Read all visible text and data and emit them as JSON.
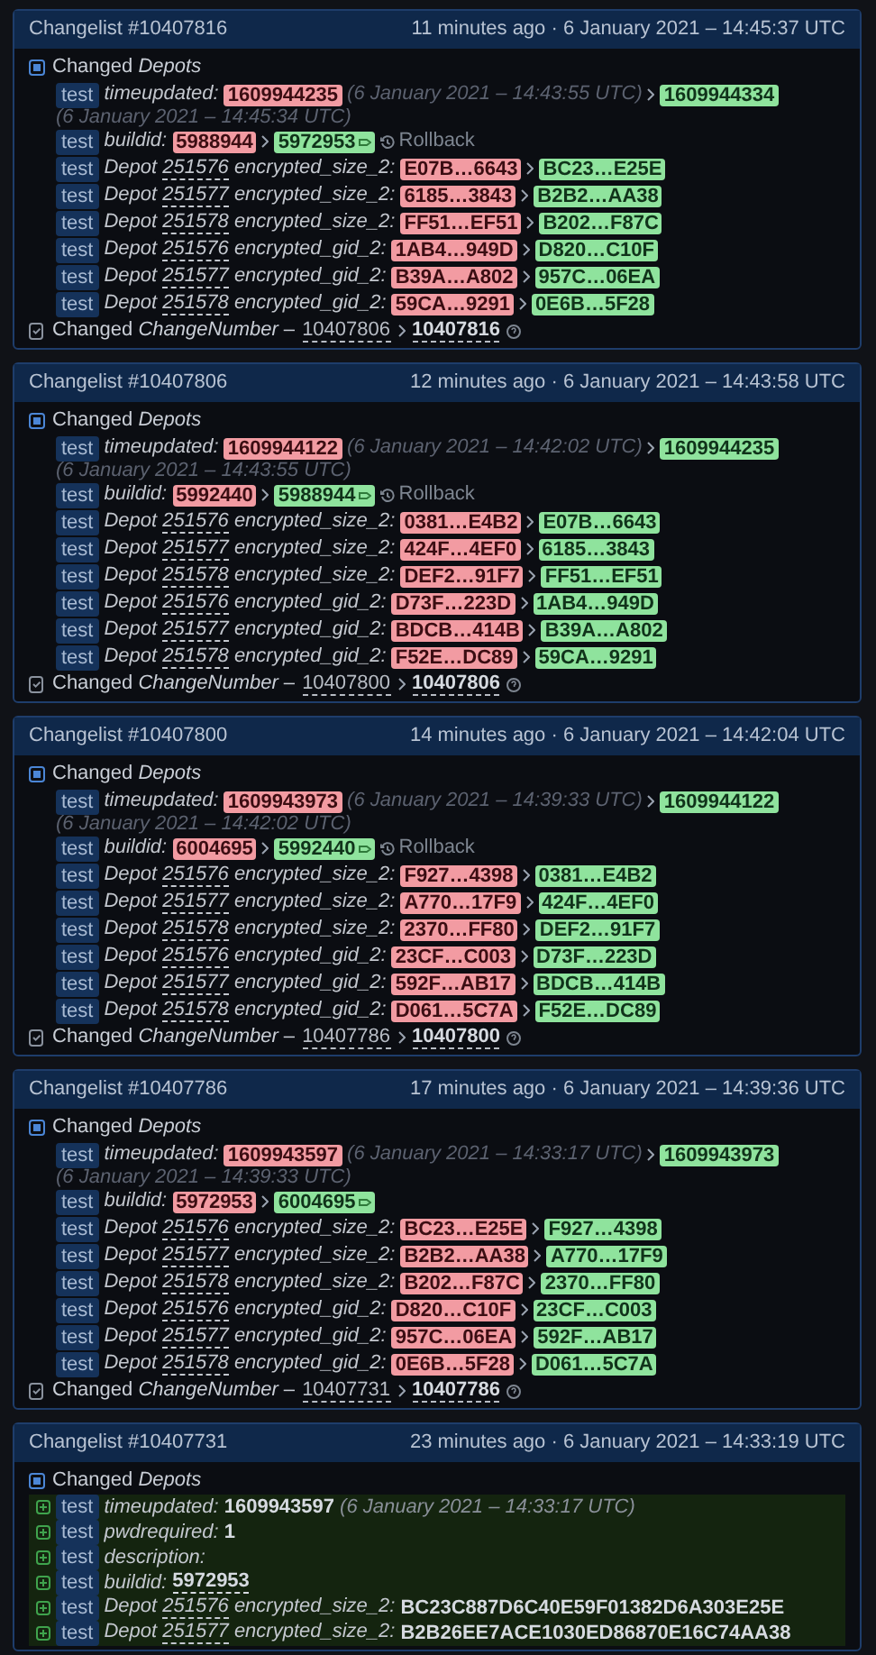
{
  "changelists": [
    {
      "title": "Changelist #10407816",
      "time": "11 minutes ago · 6 January 2021 – 14:45:37 UTC",
      "section": "Changed *Depots*",
      "rows": [
        {
          "kind": "time",
          "branch": "test",
          "key": "timeupdated:",
          "old": "1609944235",
          "old_note": "(6 January 2021 – 14:43:55 UTC)",
          "new": "1609944334",
          "new_note": "(6 January 2021 – 14:45:34 UTC)"
        },
        {
          "kind": "build",
          "branch": "test",
          "key": "buildid:",
          "old": "5988944",
          "new": "5972953",
          "rollback": "Rollback"
        },
        {
          "kind": "depot",
          "branch": "test",
          "prefix": "Depot",
          "depot": "251576",
          "key": "encrypted_size_2:",
          "old": "E07B…6643",
          "new": "BC23…E25E"
        },
        {
          "kind": "depot",
          "branch": "test",
          "prefix": "Depot",
          "depot": "251577",
          "key": "encrypted_size_2:",
          "old": "6185…3843",
          "new": "B2B2…AA38"
        },
        {
          "kind": "depot",
          "branch": "test",
          "prefix": "Depot",
          "depot": "251578",
          "key": "encrypted_size_2:",
          "old": "FF51…EF51",
          "new": "B202…F87C"
        },
        {
          "kind": "depot",
          "branch": "test",
          "prefix": "Depot",
          "depot": "251576",
          "key": "encrypted_gid_2:",
          "old": "1AB4…949D",
          "new": "D820…C10F"
        },
        {
          "kind": "depot",
          "branch": "test",
          "prefix": "Depot",
          "depot": "251577",
          "key": "encrypted_gid_2:",
          "old": "B39A…A802",
          "new": "957C…06EA"
        },
        {
          "kind": "depot",
          "branch": "test",
          "prefix": "Depot",
          "depot": "251578",
          "key": "encrypted_gid_2:",
          "old": "59CA…9291",
          "new": "0E6B…5F28"
        }
      ],
      "change_number": {
        "label": "Changed *ChangeNumber* –",
        "old": "10407806",
        "new": "10407816"
      }
    },
    {
      "title": "Changelist #10407806",
      "time": "12 minutes ago · 6 January 2021 – 14:43:58 UTC",
      "section": "Changed *Depots*",
      "rows": [
        {
          "kind": "time",
          "branch": "test",
          "key": "timeupdated:",
          "old": "1609944122",
          "old_note": "(6 January 2021 – 14:42:02 UTC)",
          "new": "1609944235",
          "new_note": "(6 January 2021 – 14:43:55 UTC)"
        },
        {
          "kind": "build",
          "branch": "test",
          "key": "buildid:",
          "old": "5992440",
          "new": "5988944",
          "rollback": "Rollback"
        },
        {
          "kind": "depot",
          "branch": "test",
          "prefix": "Depot",
          "depot": "251576",
          "key": "encrypted_size_2:",
          "old": "0381…E4B2",
          "new": "E07B…6643"
        },
        {
          "kind": "depot",
          "branch": "test",
          "prefix": "Depot",
          "depot": "251577",
          "key": "encrypted_size_2:",
          "old": "424F…4EF0",
          "new": "6185…3843"
        },
        {
          "kind": "depot",
          "branch": "test",
          "prefix": "Depot",
          "depot": "251578",
          "key": "encrypted_size_2:",
          "old": "DEF2…91F7",
          "new": "FF51…EF51"
        },
        {
          "kind": "depot",
          "branch": "test",
          "prefix": "Depot",
          "depot": "251576",
          "key": "encrypted_gid_2:",
          "old": "D73F…223D",
          "new": "1AB4…949D"
        },
        {
          "kind": "depot",
          "branch": "test",
          "prefix": "Depot",
          "depot": "251577",
          "key": "encrypted_gid_2:",
          "old": "BDCB…414B",
          "new": "B39A…A802"
        },
        {
          "kind": "depot",
          "branch": "test",
          "prefix": "Depot",
          "depot": "251578",
          "key": "encrypted_gid_2:",
          "old": "F52E…DC89",
          "new": "59CA…9291"
        }
      ],
      "change_number": {
        "label": "Changed *ChangeNumber* –",
        "old": "10407800",
        "new": "10407806"
      }
    },
    {
      "title": "Changelist #10407800",
      "time": "14 minutes ago · 6 January 2021 – 14:42:04 UTC",
      "section": "Changed *Depots*",
      "rows": [
        {
          "kind": "time",
          "branch": "test",
          "key": "timeupdated:",
          "old": "1609943973",
          "old_note": "(6 January 2021 – 14:39:33 UTC)",
          "new": "1609944122",
          "new_note": "(6 January 2021 – 14:42:02 UTC)"
        },
        {
          "kind": "build",
          "branch": "test",
          "key": "buildid:",
          "old": "6004695",
          "new": "5992440",
          "rollback": "Rollback"
        },
        {
          "kind": "depot",
          "branch": "test",
          "prefix": "Depot",
          "depot": "251576",
          "key": "encrypted_size_2:",
          "old": "F927…4398",
          "new": "0381…E4B2"
        },
        {
          "kind": "depot",
          "branch": "test",
          "prefix": "Depot",
          "depot": "251577",
          "key": "encrypted_size_2:",
          "old": "A770…17F9",
          "new": "424F…4EF0"
        },
        {
          "kind": "depot",
          "branch": "test",
          "prefix": "Depot",
          "depot": "251578",
          "key": "encrypted_size_2:",
          "old": "2370…FF80",
          "new": "DEF2…91F7"
        },
        {
          "kind": "depot",
          "branch": "test",
          "prefix": "Depot",
          "depot": "251576",
          "key": "encrypted_gid_2:",
          "old": "23CF…C003",
          "new": "D73F…223D"
        },
        {
          "kind": "depot",
          "branch": "test",
          "prefix": "Depot",
          "depot": "251577",
          "key": "encrypted_gid_2:",
          "old": "592F…AB17",
          "new": "BDCB…414B"
        },
        {
          "kind": "depot",
          "branch": "test",
          "prefix": "Depot",
          "depot": "251578",
          "key": "encrypted_gid_2:",
          "old": "D061…5C7A",
          "new": "F52E…DC89"
        }
      ],
      "change_number": {
        "label": "Changed *ChangeNumber* –",
        "old": "10407786",
        "new": "10407800"
      }
    },
    {
      "title": "Changelist #10407786",
      "time": "17 minutes ago · 6 January 2021 – 14:39:36 UTC",
      "section": "Changed *Depots*",
      "rows": [
        {
          "kind": "time",
          "branch": "test",
          "key": "timeupdated:",
          "old": "1609943597",
          "old_note": "(6 January 2021 – 14:33:17 UTC)",
          "new": "1609943973",
          "new_note": "(6 January 2021 – 14:39:33 UTC)"
        },
        {
          "kind": "build",
          "branch": "test",
          "key": "buildid:",
          "old": "5972953",
          "new": "6004695"
        },
        {
          "kind": "depot",
          "branch": "test",
          "prefix": "Depot",
          "depot": "251576",
          "key": "encrypted_size_2:",
          "old": "BC23…E25E",
          "new": "F927…4398"
        },
        {
          "kind": "depot",
          "branch": "test",
          "prefix": "Depot",
          "depot": "251577",
          "key": "encrypted_size_2:",
          "old": "B2B2…AA38",
          "new": "A770…17F9"
        },
        {
          "kind": "depot",
          "branch": "test",
          "prefix": "Depot",
          "depot": "251578",
          "key": "encrypted_size_2:",
          "old": "B202…F87C",
          "new": "2370…FF80"
        },
        {
          "kind": "depot",
          "branch": "test",
          "prefix": "Depot",
          "depot": "251576",
          "key": "encrypted_gid_2:",
          "old": "D820…C10F",
          "new": "23CF…C003"
        },
        {
          "kind": "depot",
          "branch": "test",
          "prefix": "Depot",
          "depot": "251577",
          "key": "encrypted_gid_2:",
          "old": "957C…06EA",
          "new": "592F…AB17"
        },
        {
          "kind": "depot",
          "branch": "test",
          "prefix": "Depot",
          "depot": "251578",
          "key": "encrypted_gid_2:",
          "old": "0E6B…5F28",
          "new": "D061…5C7A"
        }
      ],
      "change_number": {
        "label": "Changed *ChangeNumber* –",
        "old": "10407731",
        "new": "10407786"
      }
    },
    {
      "title": "Changelist #10407731",
      "time": "23 minutes ago · 6 January 2021 – 14:33:19 UTC",
      "section": "Changed *Depots*",
      "rows": [
        {
          "kind": "added",
          "branch": "test",
          "key": "timeupdated:",
          "value": "1609943597",
          "note": "(6 January 2021 – 14:33:17 UTC)",
          "linked": false
        },
        {
          "kind": "added",
          "branch": "test",
          "key": "pwdrequired:",
          "value": "1",
          "linked": false
        },
        {
          "kind": "added",
          "branch": "test",
          "key": "description:"
        },
        {
          "kind": "added",
          "branch": "test",
          "key": "buildid:",
          "value": "5972953",
          "linked": true
        },
        {
          "kind": "added",
          "branch": "test",
          "prefix": "Depot",
          "depot": "251576",
          "key": "encrypted_size_2:",
          "value": "BC23C887D6C40E59F01382D6A303E25E",
          "linked": false
        },
        {
          "kind": "added",
          "branch": "test",
          "prefix": "Depot",
          "depot": "251577",
          "key": "encrypted_size_2:",
          "value": "B2B26EE7ACE1030ED86870E16C74AA38",
          "linked": false
        }
      ]
    }
  ]
}
